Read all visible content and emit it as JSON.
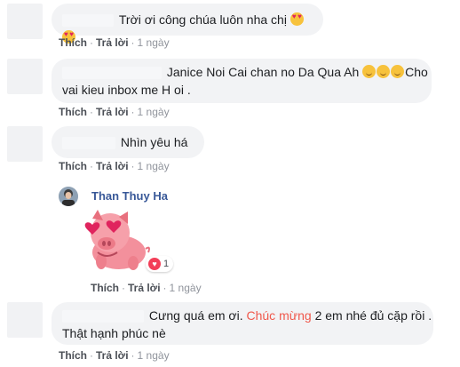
{
  "comments": [
    {
      "text": "Trời ơi công chúa luôn nha chị",
      "actions": {
        "like": "Thích",
        "reply": "Trả lời",
        "time": "1 ngày"
      }
    },
    {
      "text_line1": "Janice Noi Cai chan no Da Qua Ah",
      "text_line2": "Cho",
      "text_line3": "vai kieu inbox me H oi .",
      "actions": {
        "like": "Thích",
        "reply": "Trả lời",
        "time": "1 ngày"
      }
    },
    {
      "text": "Nhìn yêu há",
      "actions": {
        "like": "Thích",
        "reply": "Trả lời",
        "time": "1 ngày"
      }
    },
    {
      "author": "Than Thuy Ha",
      "reaction_count": "1",
      "actions": {
        "like": "Thích",
        "reply": "Trả lời",
        "time": "1 ngày"
      }
    },
    {
      "text_before": "Cưng quá em ơi.",
      "text_highlight": "Chúc mừng",
      "text_after": "2 em nhé đủ cặp rồi .",
      "text_line2": "Thật hạnh phúc nè",
      "actions": {
        "like": "Thích",
        "reply": "Trả lời",
        "time": "1 ngày"
      }
    }
  ],
  "icons": {
    "emoji_1": "heart-eyes-emoji",
    "emoji_2": "relieved-emoji",
    "sticker": "pink-pig-heart-eyes-sticker",
    "reaction": "love-reaction-icon"
  },
  "colors": {
    "bubble_bg": "#f2f3f5",
    "link": "#385898",
    "highlight": "#f0584b",
    "action_text": "#4b4f56",
    "reaction_heart": "#f33e58"
  }
}
